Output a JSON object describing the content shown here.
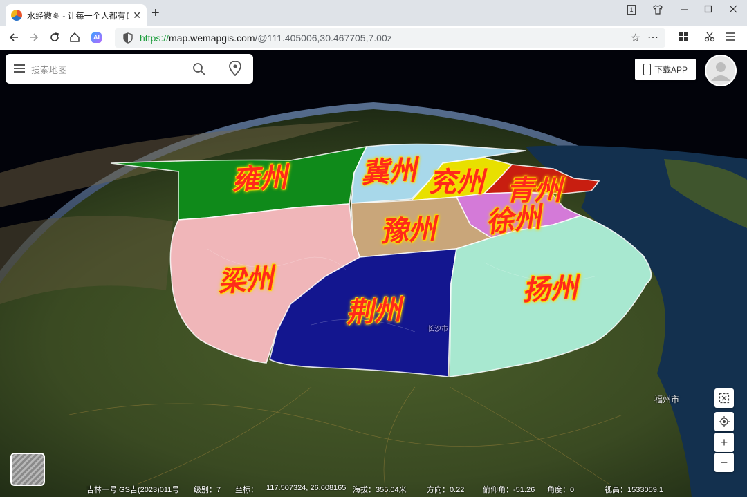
{
  "browser": {
    "tab_title": "水经微图 - 让每一个人都有自",
    "tab_close": "✕",
    "new_tab": "+",
    "window_badge": "1",
    "url_scheme": "https://",
    "url_host": "map.wemapgis.com",
    "url_path": "/@111.405006,30.467705,7.00z",
    "ai_badge": "AI"
  },
  "search": {
    "placeholder": "搜索地图"
  },
  "download": {
    "label": "下载APP"
  },
  "regions": [
    {
      "name": "雍州",
      "fill": "#0f8a1a"
    },
    {
      "name": "冀州",
      "fill": "#a8d8ea"
    },
    {
      "name": "兖州",
      "fill": "#e8e000"
    },
    {
      "name": "青州",
      "fill": "#c81e10"
    },
    {
      "name": "徐州",
      "fill": "#d47ad8"
    },
    {
      "name": "豫州",
      "fill": "#c9a67a"
    },
    {
      "name": "梁州",
      "fill": "#f0b6b9"
    },
    {
      "name": "荆州",
      "fill": "#13168f"
    },
    {
      "name": "扬州",
      "fill": "#a8e8d0"
    }
  ],
  "cities": {
    "changsha": "长沙市",
    "fuzhou": "福州市"
  },
  "status": {
    "source": "吉林一号 GS吉(2023)011号",
    "level": "级别：7",
    "coord_label": "坐标：",
    "coord_value": "117.507324, 26.608165",
    "altitude": "海拔：355.04米",
    "heading": "方向：0.22",
    "pitch": "俯仰角：-51.26",
    "angle": "角度：0",
    "view_height": "视高：1533059.1"
  },
  "tools": {
    "zoom_in": "+",
    "zoom_out": "−"
  }
}
